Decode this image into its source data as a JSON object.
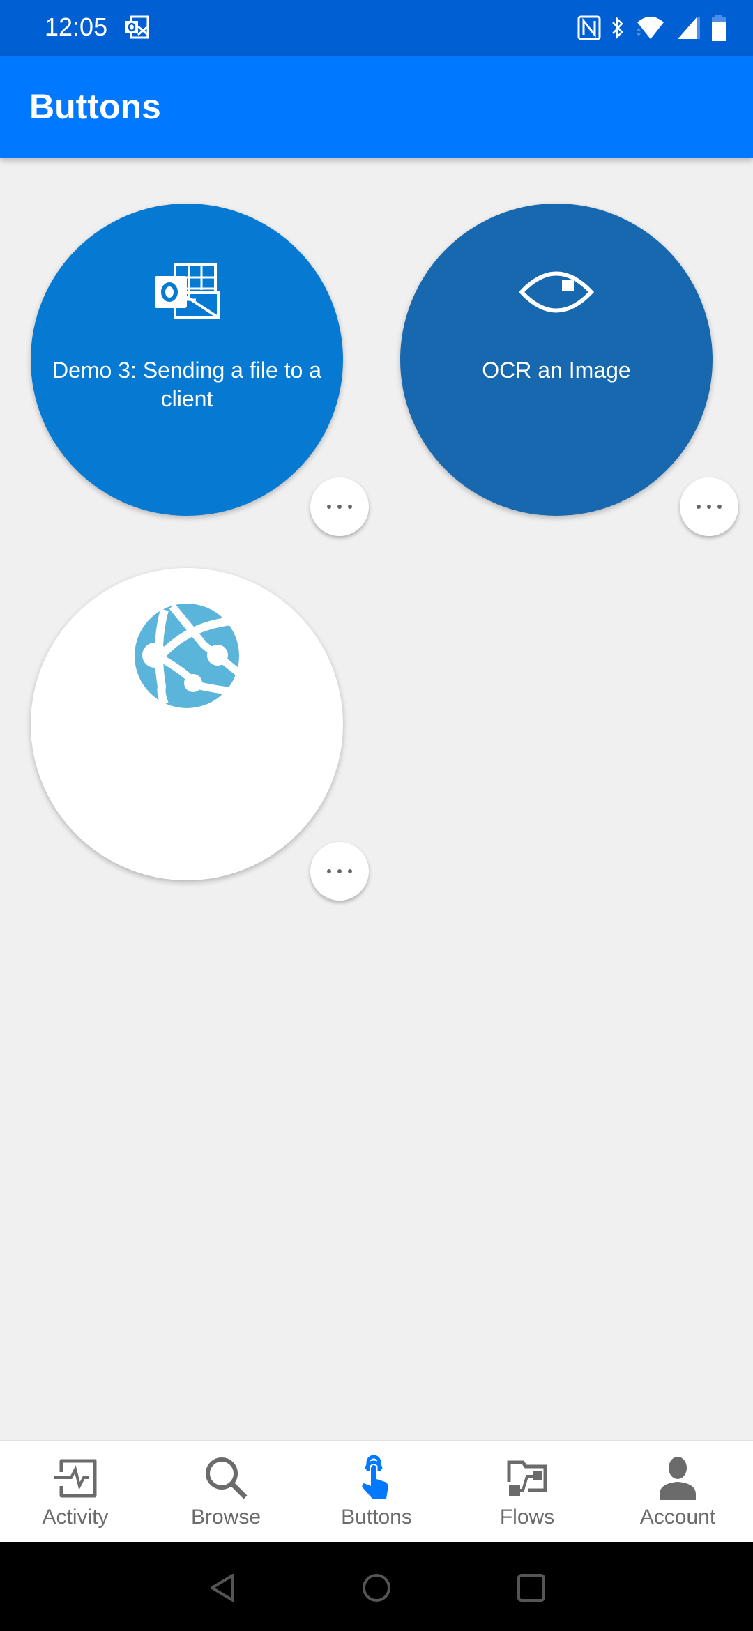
{
  "status_bar": {
    "time": "12:05",
    "icons": [
      "outlook-notification-icon",
      "nfc-icon",
      "bluetooth-icon",
      "wifi-icon",
      "cell-signal-icon",
      "battery-icon"
    ]
  },
  "app_bar": {
    "title": "Buttons"
  },
  "colors": {
    "status_bar": "#005fd3",
    "app_bar": "#0078ff",
    "tile_outlook": "#0679d3",
    "tile_ocr": "#1768ae",
    "tile_web": "#ffffff",
    "web_icon": "#5bb4d9",
    "nav_active": "#0078ff",
    "nav_inactive": "#6b6b6b"
  },
  "buttons": [
    {
      "label": "Demo 3: Sending a file to a client",
      "icon": "outlook-icon",
      "more_label": "More options"
    },
    {
      "label": "OCR an Image",
      "icon": "eye-icon",
      "more_label": "More options"
    },
    {
      "label": "",
      "icon": "web-app-globe-icon",
      "more_label": "More options"
    }
  ],
  "bottom_nav": {
    "active": "Buttons",
    "items": [
      {
        "label": "Activity",
        "icon": "activity-icon"
      },
      {
        "label": "Browse",
        "icon": "search-icon"
      },
      {
        "label": "Buttons",
        "icon": "touch-icon"
      },
      {
        "label": "Flows",
        "icon": "flows-icon"
      },
      {
        "label": "Account",
        "icon": "person-icon"
      }
    ]
  },
  "system_nav": {
    "buttons": [
      "back",
      "home",
      "recents"
    ]
  }
}
